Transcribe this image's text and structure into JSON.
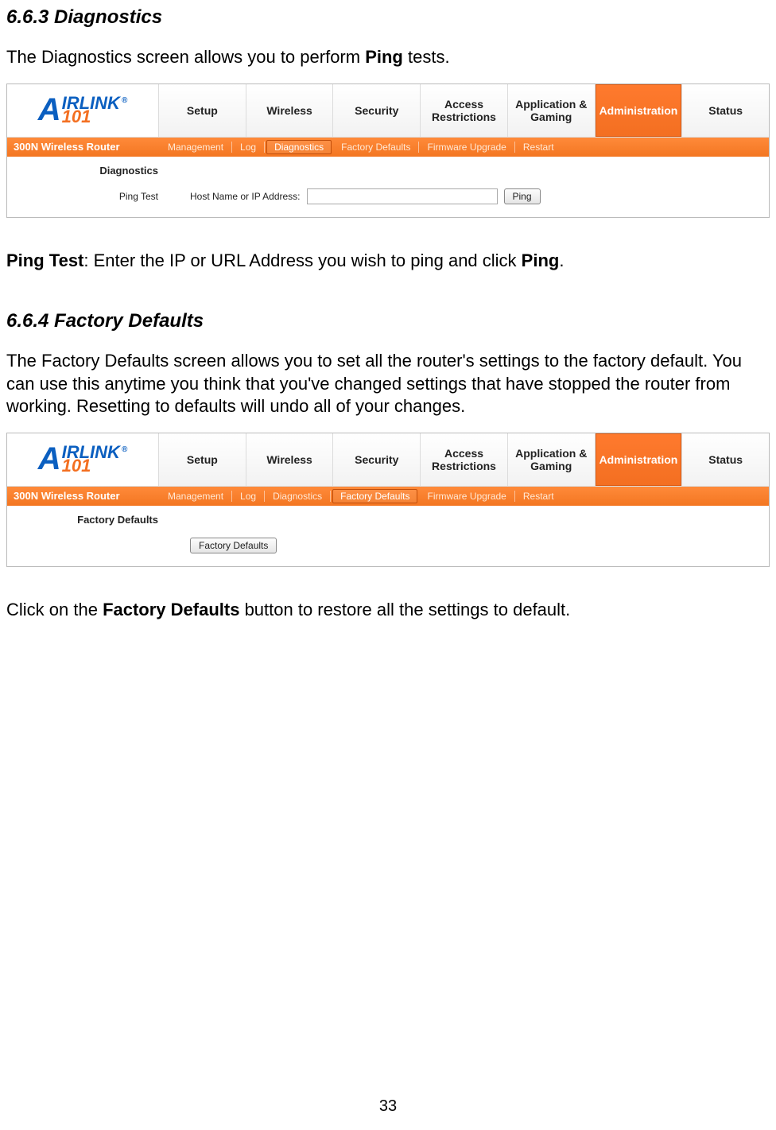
{
  "section663": {
    "heading": "6.6.3 Diagnostics",
    "intro_pre": "The Diagnostics screen allows you to perform ",
    "intro_bold": "Ping",
    "intro_post": " tests.",
    "desc_bold1": "Ping Test",
    "desc_mid": ": Enter the IP or URL Address you wish to ping and click ",
    "desc_bold2": "Ping",
    "desc_post": "."
  },
  "section664": {
    "heading": "6.6.4 Factory Defaults",
    "intro": "The Factory Defaults screen allows you to set all the router's settings to the factory default.  You can use this anytime you think that you've changed settings that have stopped the router from working.  Resetting to defaults will undo all of your changes.",
    "desc_pre": "Click on the ",
    "desc_bold": "Factory Defaults",
    "desc_post": " button to restore all the settings to default."
  },
  "router": {
    "logo_a": "A",
    "logo_line1": "IRLINK",
    "logo_line2": "101",
    "logo_r": "®",
    "device": "300N Wireless Router",
    "tabs": [
      "Setup",
      "Wireless",
      "Security",
      "Access Restrictions",
      "Application & Gaming",
      "Administration",
      "Status"
    ],
    "subtabs": [
      "Management",
      "Log",
      "Diagnostics",
      "Factory Defaults",
      "Firmware Upgrade",
      "Restart"
    ]
  },
  "diag": {
    "panel_title": "Diagnostics",
    "row_label": "Ping Test",
    "field_label": "Host Name or IP Address:",
    "button": "Ping"
  },
  "fd": {
    "panel_title": "Factory Defaults",
    "button": "Factory Defaults"
  },
  "page_number": "33"
}
